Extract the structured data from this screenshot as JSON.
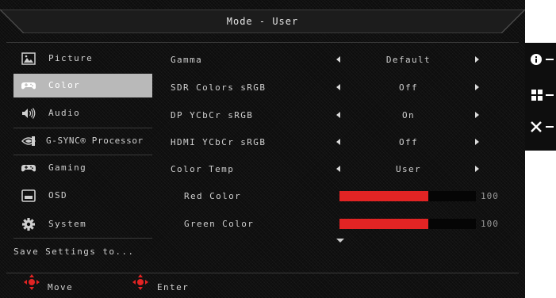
{
  "title": "Mode - User",
  "sidebar": {
    "items": [
      {
        "label": "Picture",
        "icon": "picture-icon",
        "active": false
      },
      {
        "label": "Color",
        "icon": "gamepad-icon",
        "active": true
      },
      {
        "label": "Audio",
        "icon": "speaker-icon",
        "active": false
      },
      {
        "label": "G-SYNC® Processor",
        "icon": "nvidia-icon",
        "active": false
      },
      {
        "label": "Gaming",
        "icon": "gamepad-icon",
        "active": false
      },
      {
        "label": "OSD",
        "icon": "osd-screen-icon",
        "active": false
      },
      {
        "label": "System",
        "icon": "gear-icon",
        "active": false
      }
    ],
    "save_settings": "Save Settings to..."
  },
  "settings": {
    "rows": [
      {
        "label": "Gamma",
        "value": "Default"
      },
      {
        "label": "SDR Colors sRGB",
        "value": "Off"
      },
      {
        "label": "DP YCbCr sRGB",
        "value": "On"
      },
      {
        "label": "HDMI YCbCr sRGB",
        "value": "Off"
      },
      {
        "label": "Color Temp",
        "value": "User"
      }
    ],
    "sliders": [
      {
        "label": "Red Color",
        "value": "100",
        "level_fraction": 0.65
      },
      {
        "label": "Green Color",
        "value": "100",
        "level_fraction": 0.65
      }
    ]
  },
  "footer": {
    "move_label": "Move",
    "enter_label": "Enter"
  },
  "hotkeys": [
    {
      "icon": "info-icon"
    },
    {
      "icon": "menu-grid-icon"
    },
    {
      "icon": "close-icon"
    }
  ],
  "colors": {
    "accent_red": "#e22424",
    "active_item_bg": "#b9b9b9"
  }
}
